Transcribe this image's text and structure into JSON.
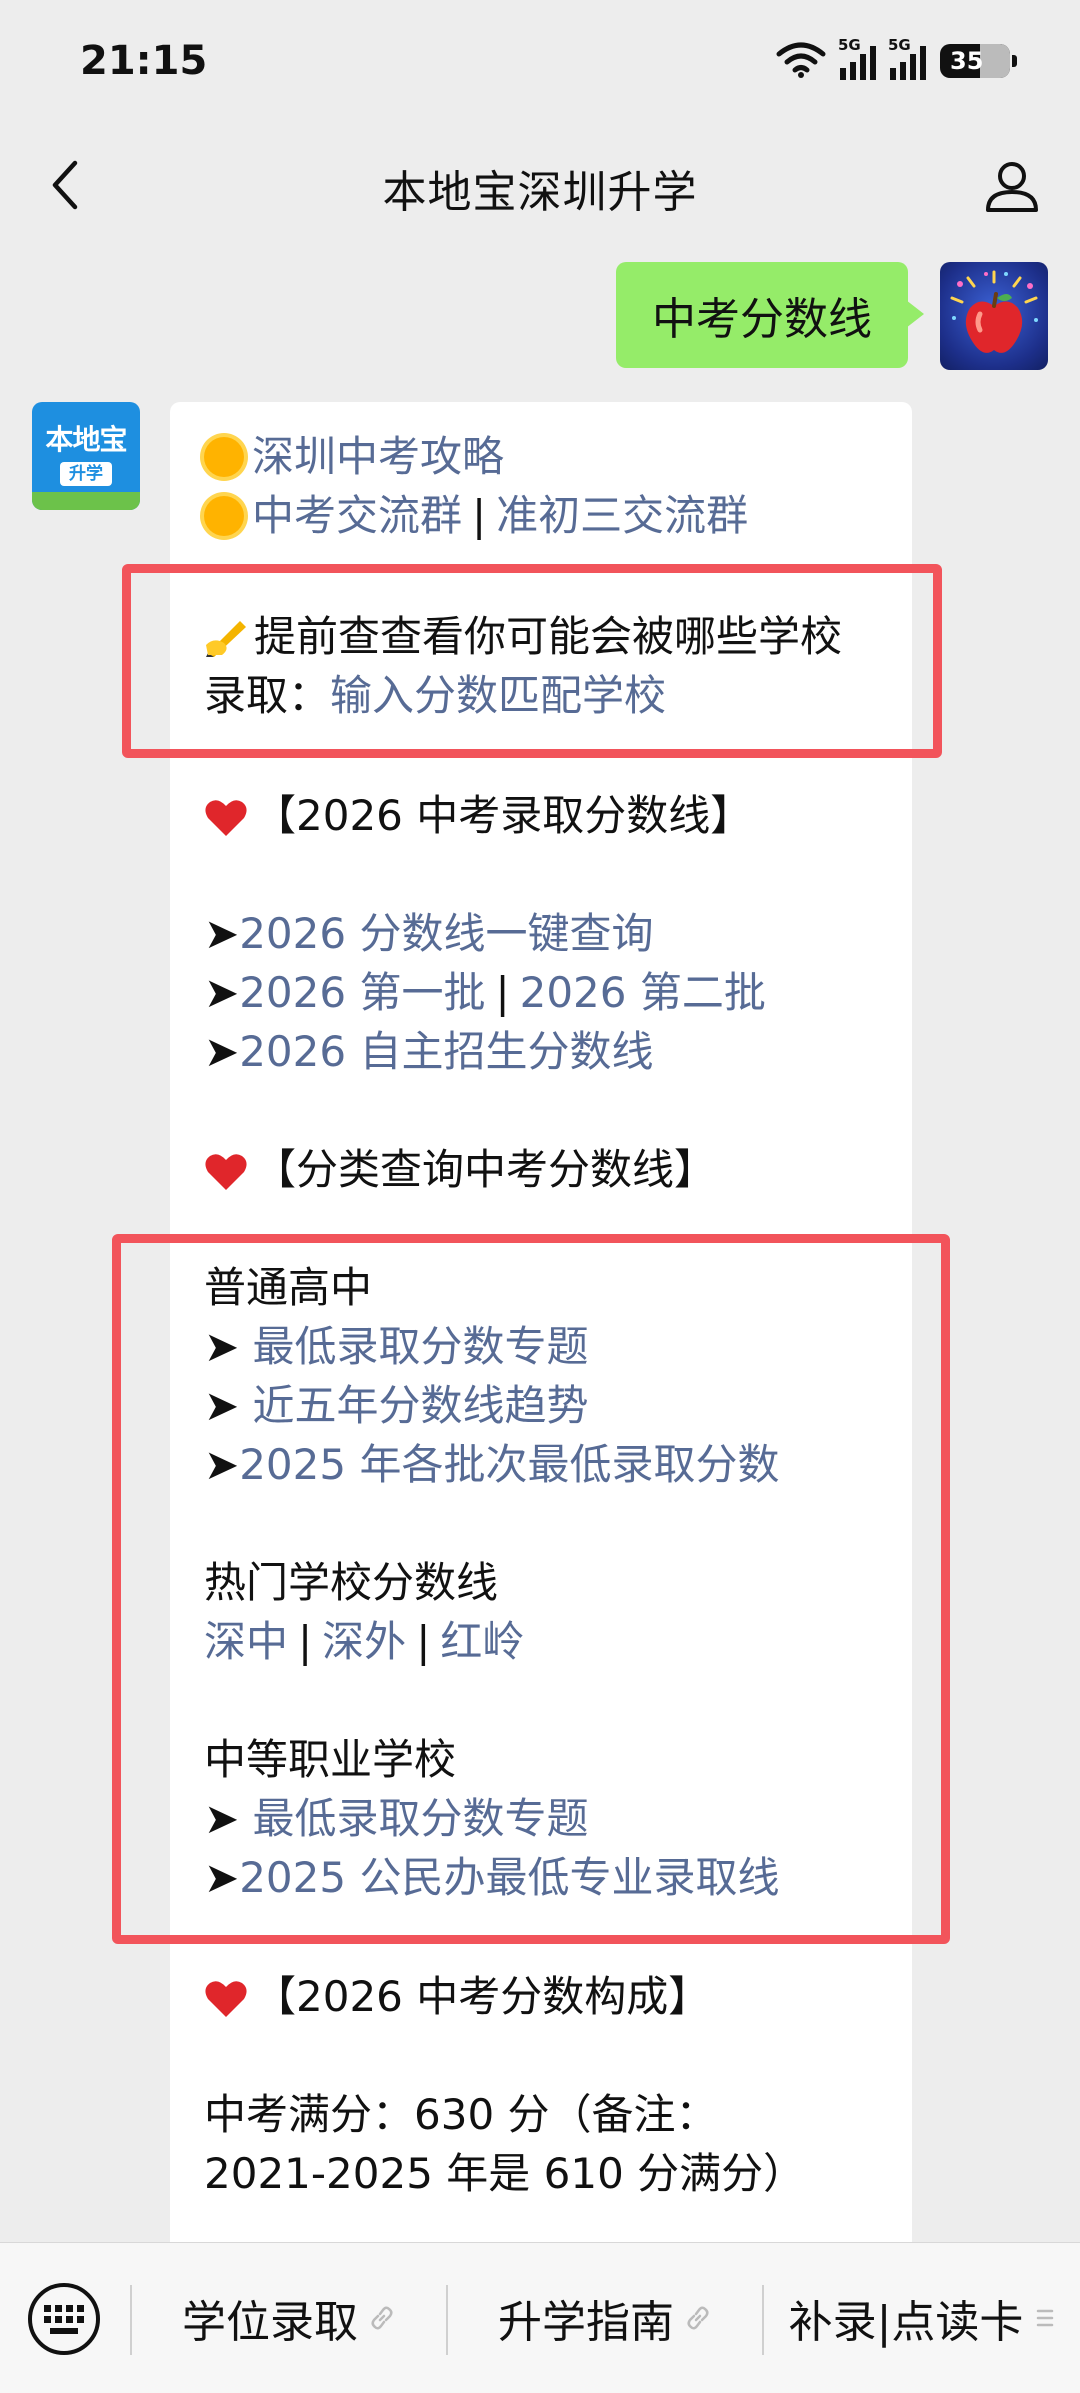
{
  "status_bar": {
    "time": "21:15",
    "signal_1": "5G",
    "signal_2": "5G",
    "battery": "35"
  },
  "header": {
    "title": "本地宝深圳升学"
  },
  "user_message": {
    "text": "中考分数线"
  },
  "bot": {
    "avatar_text": "本地宝",
    "avatar_sub": "升学",
    "line1": {
      "link": "深圳中考攻略"
    },
    "line2": {
      "link_a": "中考交流群",
      "sep": "|",
      "link_b": "准初三交流群"
    },
    "line3": {
      "text": "提前查查看你可能会被哪些学校"
    },
    "line4": {
      "prefix": "录取：",
      "link": "输入分数匹配学校"
    },
    "section1": "【2026 中考录取分数线】",
    "s1_items": [
      {
        "arrow": "➤",
        "link": "2026 分数线一键查询"
      },
      {
        "arrow": "➤",
        "link_a": "2026 第一批",
        "sep": "|",
        "link_b": "2026 第二批"
      },
      {
        "arrow": "➤",
        "link": "2026 自主招生分数线"
      }
    ],
    "section2": "【分类查询中考分数线】",
    "group1": {
      "title": "普通高中",
      "items": [
        {
          "arrow": "➤",
          "link": " 最低录取分数专题"
        },
        {
          "arrow": "➤",
          "link": " 近五年分数线趋势"
        },
        {
          "arrow": "➤",
          "link": "2025 年各批次最低录取分数"
        }
      ]
    },
    "group2": {
      "title": "热门学校分数线",
      "link_a": "深中",
      "sep": "|",
      "link_b": "深外",
      "link_c": "红岭"
    },
    "group3": {
      "title": "中等职业学校",
      "items": [
        {
          "arrow": "➤",
          "link": " 最低录取分数专题"
        },
        {
          "arrow": "➤",
          "link": "2025 公民办最低专业录取线"
        }
      ]
    },
    "section3": "【2026 中考分数构成】",
    "score_line1": "中考满分：630 分（备注：",
    "score_line2": "2021-2025 年是 610 分满分）"
  },
  "bottom_menu": {
    "item1": "学位录取",
    "item2": "升学指南",
    "item3": "补录|点读卡"
  },
  "colors": {
    "link": "#576b95",
    "user_bubble": "#95ec69",
    "highlight_box": "#f2545b"
  }
}
